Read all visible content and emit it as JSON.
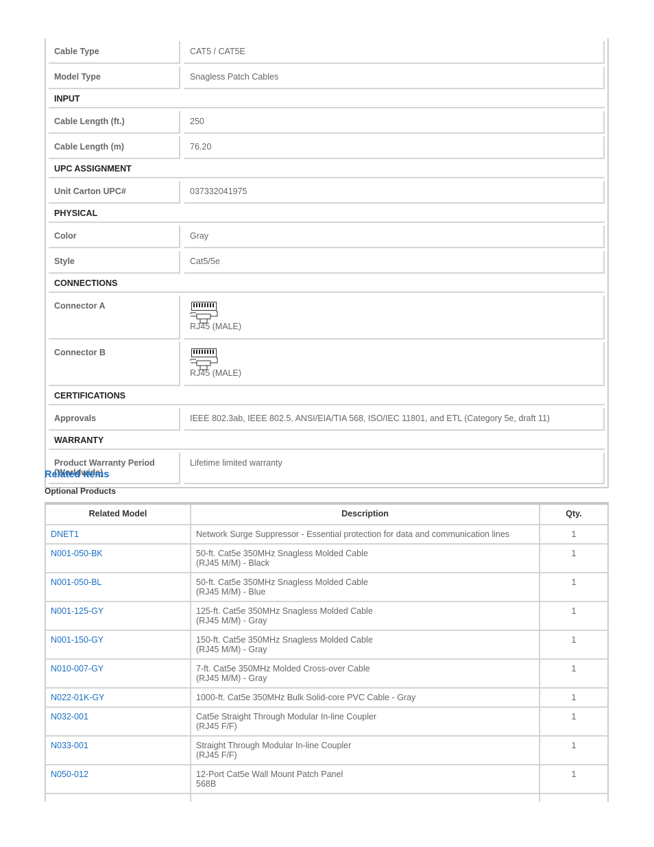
{
  "specs": {
    "rows": [
      {
        "type": "row",
        "label": "Cable Type",
        "value": "CAT5 / CAT5E"
      },
      {
        "type": "row",
        "label": "Model Type",
        "value": "Snagless Patch Cables"
      },
      {
        "type": "section",
        "label": "INPUT"
      },
      {
        "type": "row",
        "label": "Cable Length (ft.)",
        "value": "250"
      },
      {
        "type": "row",
        "label": "Cable Length (m)",
        "value": "76.20"
      },
      {
        "type": "section",
        "label": "UPC ASSIGNMENT"
      },
      {
        "type": "row",
        "label": "Unit Carton UPC#",
        "value": "037332041975"
      },
      {
        "type": "section",
        "label": "PHYSICAL"
      },
      {
        "type": "row",
        "label": "Color",
        "value": "Gray"
      },
      {
        "type": "row",
        "label": "Style",
        "value": "Cat5/5e"
      },
      {
        "type": "section",
        "label": "CONNECTIONS"
      },
      {
        "type": "connector",
        "label": "Connector A",
        "value": "RJ45 (MALE)",
        "icon": "rj45-connector-icon"
      },
      {
        "type": "connector",
        "label": "Connector B",
        "value": "RJ45 (MALE)",
        "icon": "rj45-connector-icon"
      },
      {
        "type": "section",
        "label": "CERTIFICATIONS"
      },
      {
        "type": "row",
        "label": "Approvals",
        "value": "IEEE 802.3ab, IEEE 802.5, ANSI/EIA/TIA 568, ISO/IEC 11801, and ETL (Category 5e, draft 11)"
      },
      {
        "type": "section",
        "label": "WARRANTY"
      },
      {
        "type": "tall",
        "label": "Product Warranty Period (Worldwide)",
        "value": "Lifetime limited warranty"
      }
    ]
  },
  "related": {
    "title": "Related Items",
    "subtitle": "Optional Products",
    "link_color": "#1a6fc4",
    "headers": [
      "Related Model",
      "Description",
      "Qty."
    ],
    "items": [
      {
        "model": "DNET1",
        "desc": [
          "Network Surge Suppressor - Essential protection for data and communication lines"
        ],
        "qty": "1"
      },
      {
        "model": "N001-050-BK",
        "desc": [
          "50-ft. Cat5e 350MHz Snagless Molded Cable",
          "(RJ45 M/M) - Black"
        ],
        "qty": "1"
      },
      {
        "model": "N001-050-BL",
        "desc": [
          "50-ft. Cat5e 350MHz Snagless Molded Cable",
          "(RJ45 M/M) - Blue"
        ],
        "qty": "1"
      },
      {
        "model": "N001-125-GY",
        "desc": [
          "125-ft. Cat5e 350MHz Snagless Molded Cable",
          "(RJ45 M/M) - Gray"
        ],
        "qty": "1"
      },
      {
        "model": "N001-150-GY",
        "desc": [
          "150-ft. Cat5e 350MHz Snagless Molded Cable",
          "(RJ45 M/M) - Gray"
        ],
        "qty": "1"
      },
      {
        "model": "N010-007-GY",
        "desc": [
          "7-ft. Cat5e 350MHz Molded Cross-over Cable",
          "(RJ45 M/M) - Gray"
        ],
        "qty": "1"
      },
      {
        "model": "N022-01K-GY",
        "desc": [
          "1000-ft. Cat5e 350MHz Bulk Solid-core PVC Cable - Gray"
        ],
        "qty": "1"
      },
      {
        "model": "N032-001",
        "desc": [
          "Cat5e Straight Through Modular In-line Coupler",
          "(RJ45 F/F)"
        ],
        "qty": "1"
      },
      {
        "model": "N033-001",
        "desc": [
          "Straight Through Modular In-line Coupler",
          "(RJ45 F/F)"
        ],
        "qty": "1"
      },
      {
        "model": "N050-012",
        "desc": [
          "12-Port Cat5e Wall Mount Patch Panel",
          "568B"
        ],
        "qty": "1"
      }
    ]
  }
}
